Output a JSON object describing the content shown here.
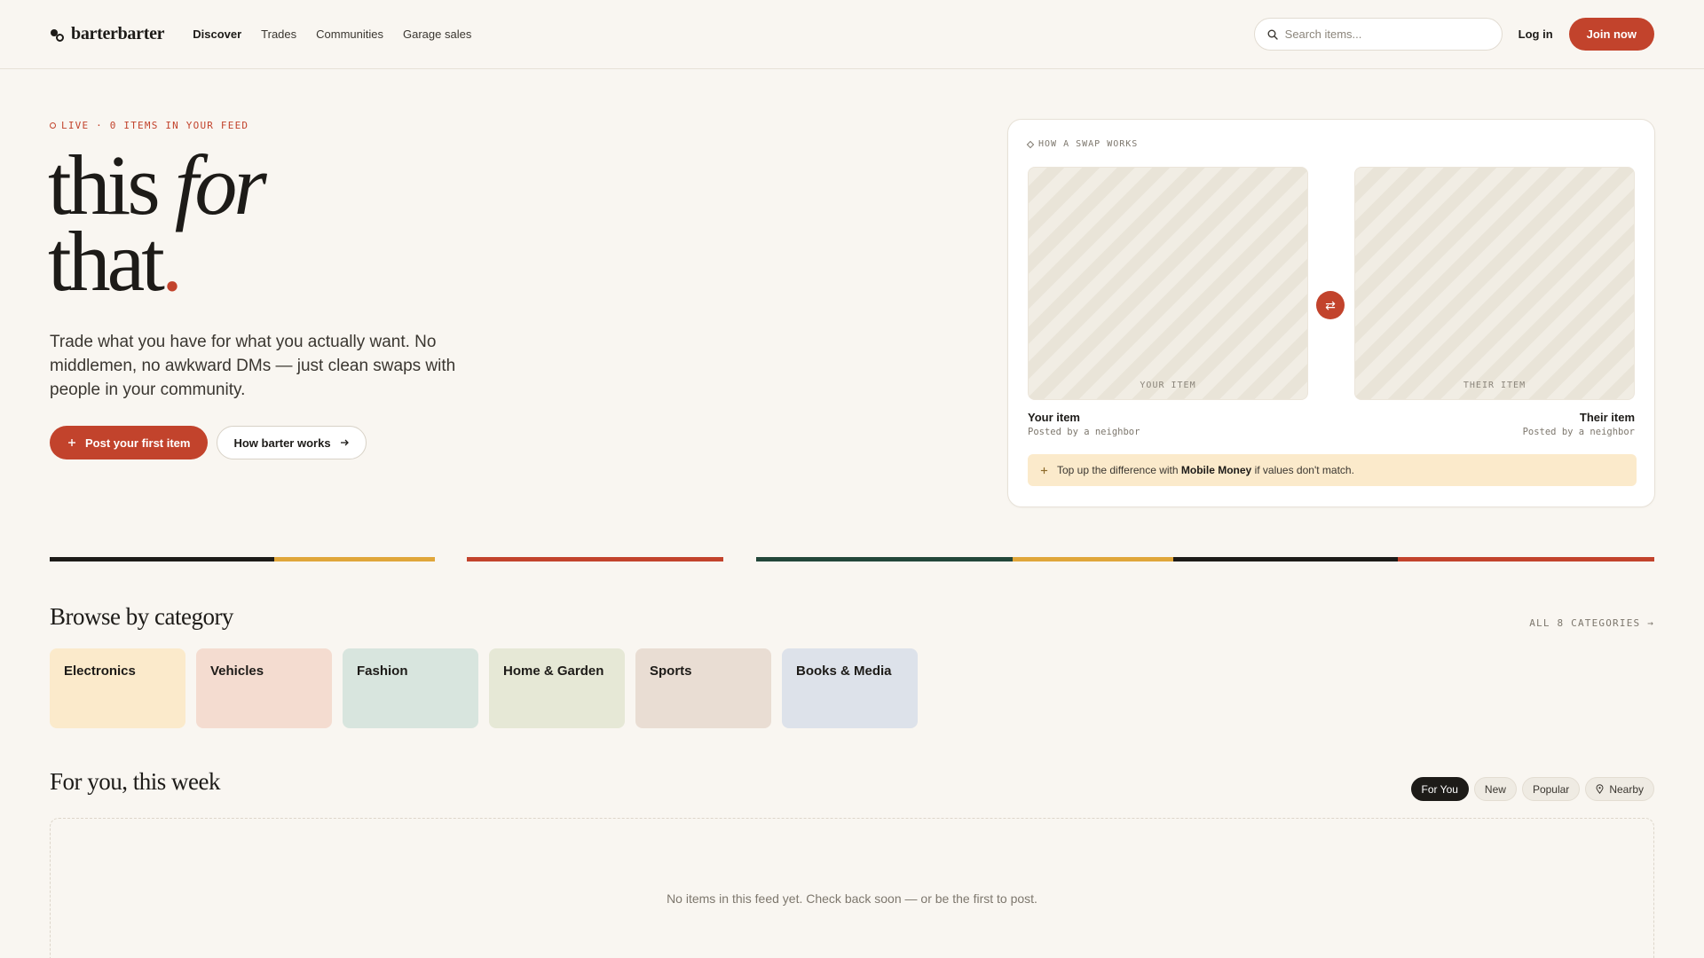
{
  "nav": {
    "logo": "barterbarter",
    "links": [
      "Discover",
      "Trades",
      "Communities",
      "Garage sales"
    ],
    "search_placeholder": "Search items...",
    "login": "Log in",
    "join": "Join now"
  },
  "hero": {
    "live": "LIVE · 0 ITEMS IN YOUR FEED",
    "headline_1": "this",
    "headline_em": "for",
    "headline_2": "that",
    "headline_dot": ".",
    "lede": "Trade what you have for what you actually want. No middlemen, no awkward DMs — just clean swaps with people in your community.",
    "primary_cta": "Post your first item",
    "secondary_cta": "How barter works"
  },
  "swap": {
    "label": "HOW A SWAP WORKS",
    "your_caption": "YOUR ITEM",
    "their_caption": "THEIR ITEM",
    "your_title": "Your item",
    "your_sub": "Posted by a neighbor",
    "their_title": "Their item",
    "their_sub": "Posted by a neighbor",
    "topup_pre": "Top up the difference with",
    "topup_bold": "Mobile Money",
    "topup_post": "if values don't match."
  },
  "colors": {
    "accent": "#c2432c",
    "ink": "#1d1b18",
    "gold": "#e0a63a",
    "forest": "#23473a"
  },
  "categories": {
    "title": "Browse by category",
    "all": "ALL 8 CATEGORIES →",
    "items": [
      {
        "label": "Electronics",
        "color": "#fbeacb"
      },
      {
        "label": "Vehicles",
        "color": "#f4dcd0"
      },
      {
        "label": "Fashion",
        "color": "#d8e5de"
      },
      {
        "label": "Home & Garden",
        "color": "#e6e8d6"
      },
      {
        "label": "Sports",
        "color": "#e9ddd3"
      },
      {
        "label": "Books & Media",
        "color": "#dde2ea"
      }
    ]
  },
  "feed": {
    "title": "For you, this week",
    "tabs": [
      "For You",
      "New",
      "Popular",
      "Nearby"
    ],
    "active_tab": "For You",
    "empty": "No items in this feed yet. Check back soon — or be the first to post."
  }
}
